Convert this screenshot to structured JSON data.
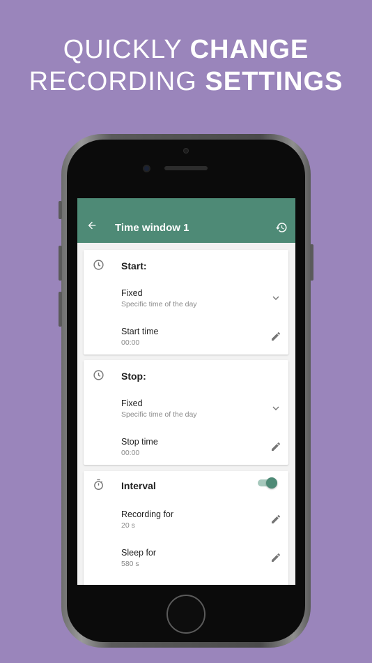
{
  "headline": {
    "line1_light": "QUICKLY",
    "line1_bold": "CHANGE",
    "line2_light": "RECORDING",
    "line2_bold": "SETTINGS"
  },
  "colors": {
    "background": "#9a85bb",
    "appbar": "#4e8a76",
    "toggle_on": "#4e8a76"
  },
  "appbar": {
    "title": "Time window 1",
    "back_icon": "arrow-left-icon",
    "restore_icon": "restore-history-icon"
  },
  "start_card": {
    "label": "Start:",
    "icon": "clock-icon",
    "mode": {
      "primary": "Fixed",
      "secondary": "Specific time of the day",
      "icon": "chevron-down-icon"
    },
    "time": {
      "primary": "Start time",
      "secondary": "00:00",
      "icon": "pencil-icon"
    }
  },
  "stop_card": {
    "label": "Stop:",
    "icon": "clock-icon",
    "mode": {
      "primary": "Fixed",
      "secondary": "Specific time of the day",
      "icon": "chevron-down-icon"
    },
    "time": {
      "primary": "Stop time",
      "secondary": "00:00",
      "icon": "pencil-icon"
    }
  },
  "interval_card": {
    "label": "Interval",
    "icon": "stopwatch-icon",
    "enabled": true,
    "recording": {
      "primary": "Recording for",
      "secondary": "20 s",
      "icon": "pencil-icon"
    },
    "sleep": {
      "primary": "Sleep for",
      "secondary": "580 s",
      "icon": "pencil-icon"
    }
  }
}
